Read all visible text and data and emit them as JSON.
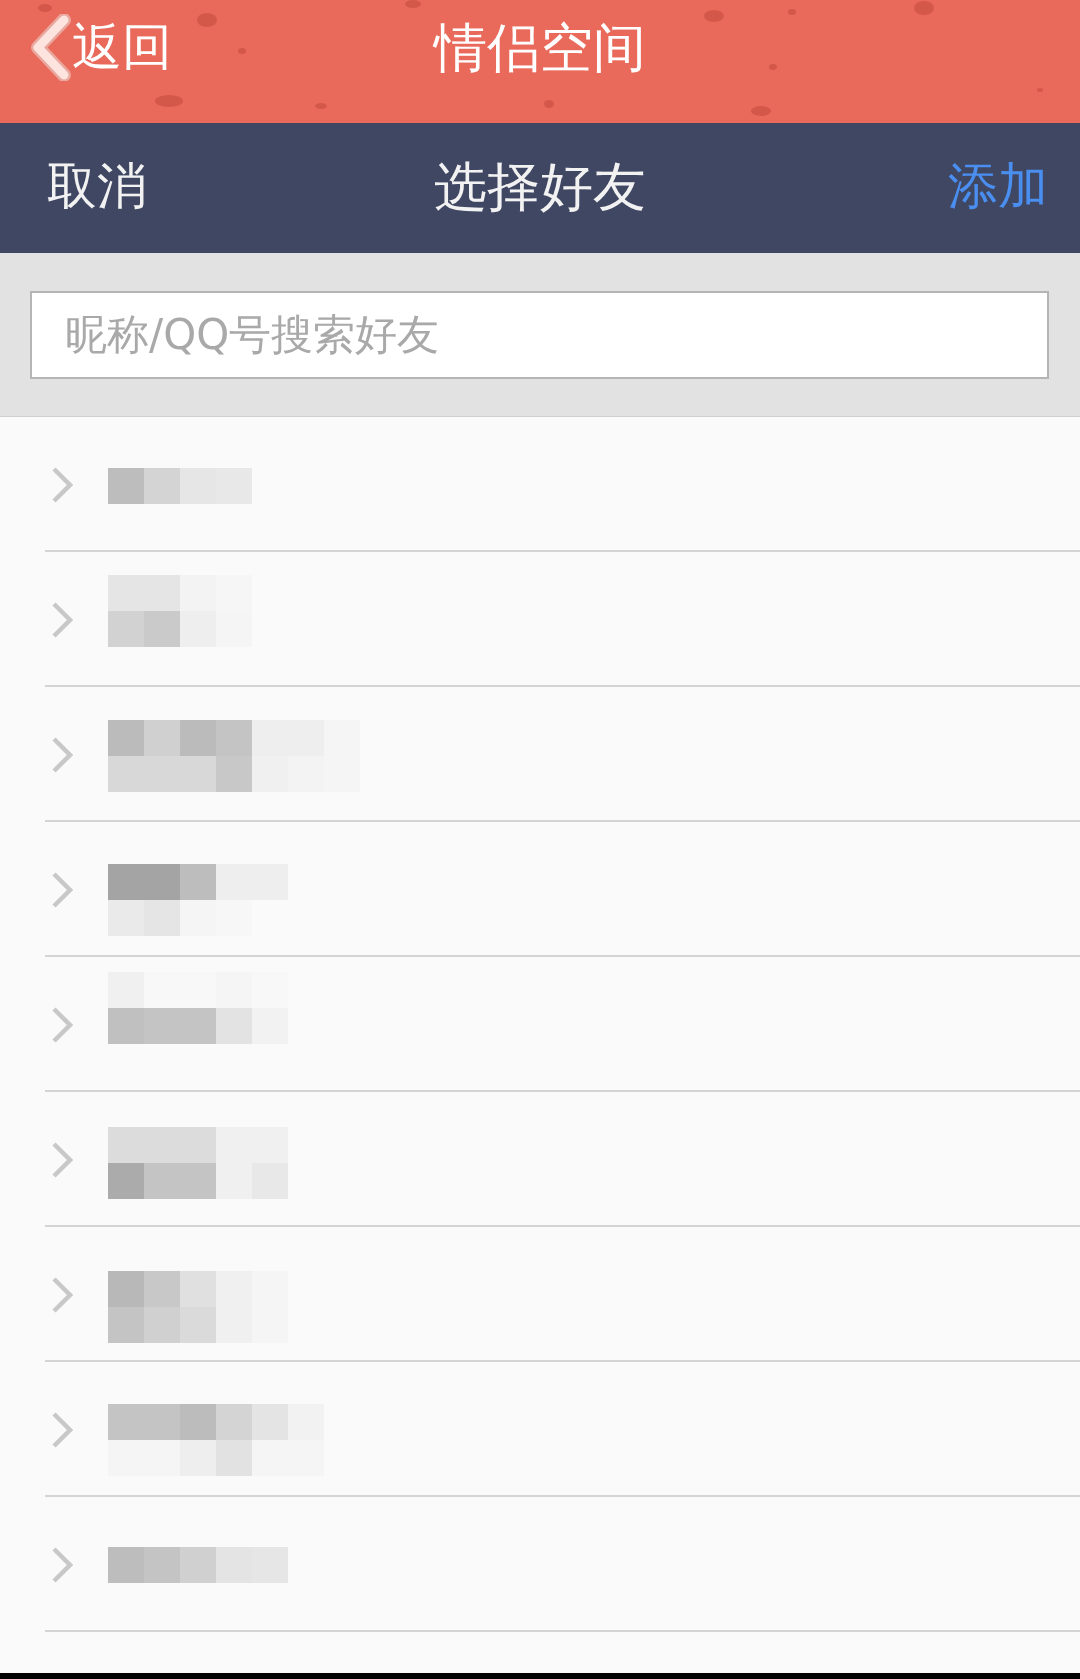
{
  "header": {
    "back_label": "返回",
    "title": "情侣空间"
  },
  "nav_bar": {
    "cancel_label": "取消",
    "title": "选择好友",
    "add_label": "添加"
  },
  "search": {
    "placeholder": "昵称/QQ号搜索好友"
  },
  "friend_groups": [
    {
      "expanded": false
    },
    {
      "expanded": false
    },
    {
      "expanded": false
    },
    {
      "expanded": false
    },
    {
      "expanded": false
    },
    {
      "expanded": false
    },
    {
      "expanded": false
    },
    {
      "expanded": false
    },
    {
      "expanded": false
    }
  ]
}
